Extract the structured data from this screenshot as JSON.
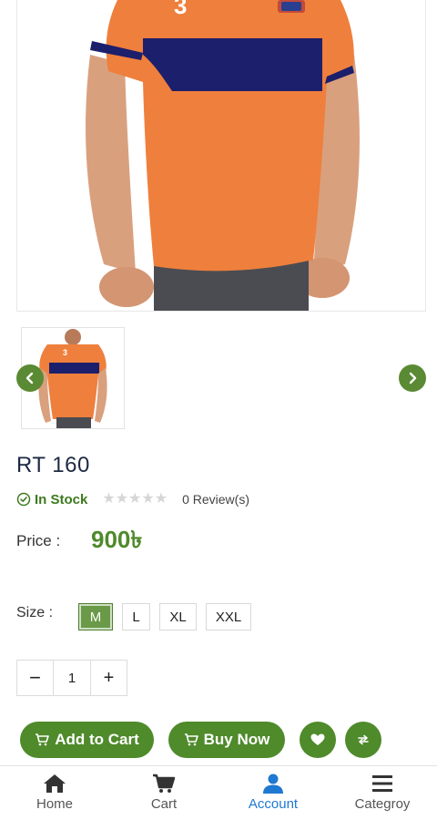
{
  "product": {
    "title": "RT 160",
    "stock": "In Stock",
    "rating": 0,
    "max_rating": 5,
    "reviews": "0 Review(s)",
    "price_label": "Price :",
    "price": "900৳"
  },
  "size": {
    "label": "Size :",
    "options": [
      "M",
      "L",
      "XL",
      "XXL"
    ],
    "selected": "M"
  },
  "quantity": {
    "minus": "−",
    "value": "1",
    "plus": "+"
  },
  "actions": {
    "add_to_cart": "Add to Cart",
    "buy_now": "Buy Now"
  },
  "colors": {
    "accent": "#4f8a2b",
    "active_nav": "#1f78d1",
    "shirt": "#ef7f3c",
    "stripe": "#1c1f6b"
  },
  "icons": {
    "prev": "chevron-left-icon",
    "next": "chevron-right-icon",
    "stock": "check-circle-icon",
    "cart": "cart-icon",
    "wishlist": "heart-icon",
    "compare": "swap-icon"
  },
  "bottom_nav": [
    {
      "label": "Home",
      "icon": "home-icon"
    },
    {
      "label": "Cart",
      "icon": "cart-icon"
    },
    {
      "label": "Account",
      "icon": "user-icon",
      "active": true
    },
    {
      "label": "Categroy",
      "icon": "menu-icon"
    }
  ]
}
